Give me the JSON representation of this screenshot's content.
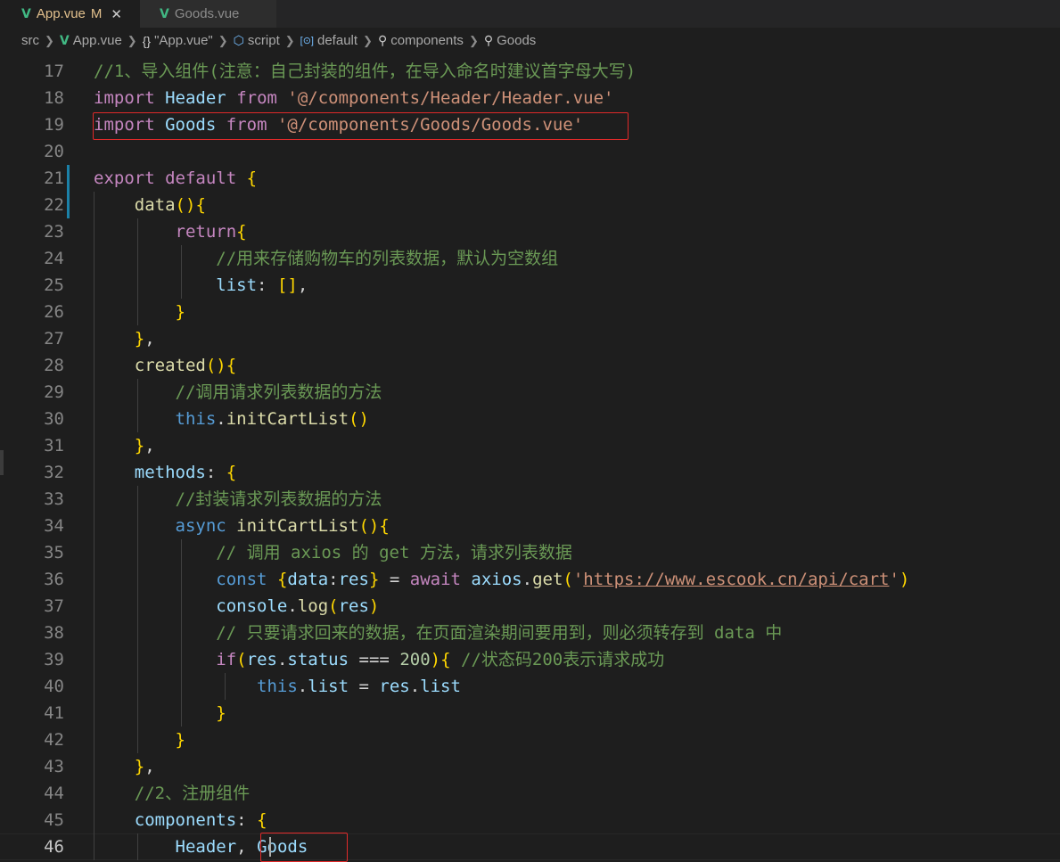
{
  "tabs": [
    {
      "label": "App.vue",
      "modified": "M",
      "close": "✕",
      "active": true
    },
    {
      "label": "Goods.vue",
      "active": false
    }
  ],
  "breadcrumbs": [
    "src",
    "App.vue",
    "\"App.vue\"",
    "script",
    "default",
    "components",
    "Goods"
  ],
  "breadcrumb_icons": {
    "braces": "{}",
    "script": "⬡",
    "default": "[⊙]",
    "wrench": "🔧"
  },
  "code_lines": [
    {
      "n": "17",
      "text": "//1、导入组件(注意：自己封装的组件，在导入命名时建议首字母大写)"
    },
    {
      "n": "18",
      "text": "import Header from '@/components/Header/Header.vue'"
    },
    {
      "n": "19",
      "text": "import Goods from '@/components/Goods/Goods.vue'"
    },
    {
      "n": "20",
      "text": ""
    },
    {
      "n": "21",
      "text": "export default {"
    },
    {
      "n": "22",
      "text": "    data(){"
    },
    {
      "n": "23",
      "text": "        return{"
    },
    {
      "n": "24",
      "text": "            //用来存储购物车的列表数据，默认为空数组"
    },
    {
      "n": "25",
      "text": "            list: [],"
    },
    {
      "n": "26",
      "text": "        }"
    },
    {
      "n": "27",
      "text": "    },"
    },
    {
      "n": "28",
      "text": "    created(){"
    },
    {
      "n": "29",
      "text": "        //调用请求列表数据的方法"
    },
    {
      "n": "30",
      "text": "        this.initCartList()"
    },
    {
      "n": "31",
      "text": "    },"
    },
    {
      "n": "32",
      "text": "    methods: {"
    },
    {
      "n": "33",
      "text": "        //封装请求列表数据的方法"
    },
    {
      "n": "34",
      "text": "        async initCartList(){"
    },
    {
      "n": "35",
      "text": "            // 调用 axios 的 get 方法，请求列表数据"
    },
    {
      "n": "36",
      "text": "            const {data:res} = await axios.get('https://www.escook.cn/api/cart')"
    },
    {
      "n": "37",
      "text": "            console.log(res)"
    },
    {
      "n": "38",
      "text": "            // 只要请求回来的数据，在页面渲染期间要用到，则必须转存到 data 中"
    },
    {
      "n": "39",
      "text": "            if(res.status === 200){ //状态码200表示请求成功"
    },
    {
      "n": "40",
      "text": "                this.list = res.list"
    },
    {
      "n": "41",
      "text": "            }"
    },
    {
      "n": "42",
      "text": "        }"
    },
    {
      "n": "43",
      "text": "    },"
    },
    {
      "n": "44",
      "text": "    //2、注册组件"
    },
    {
      "n": "45",
      "text": "    components: {"
    },
    {
      "n": "46",
      "text": "        Header, Goods"
    }
  ],
  "colors": {
    "highlight_box": "#e02a2a",
    "modified_tab": "#e2c08d",
    "vue_green": "#41b883"
  }
}
